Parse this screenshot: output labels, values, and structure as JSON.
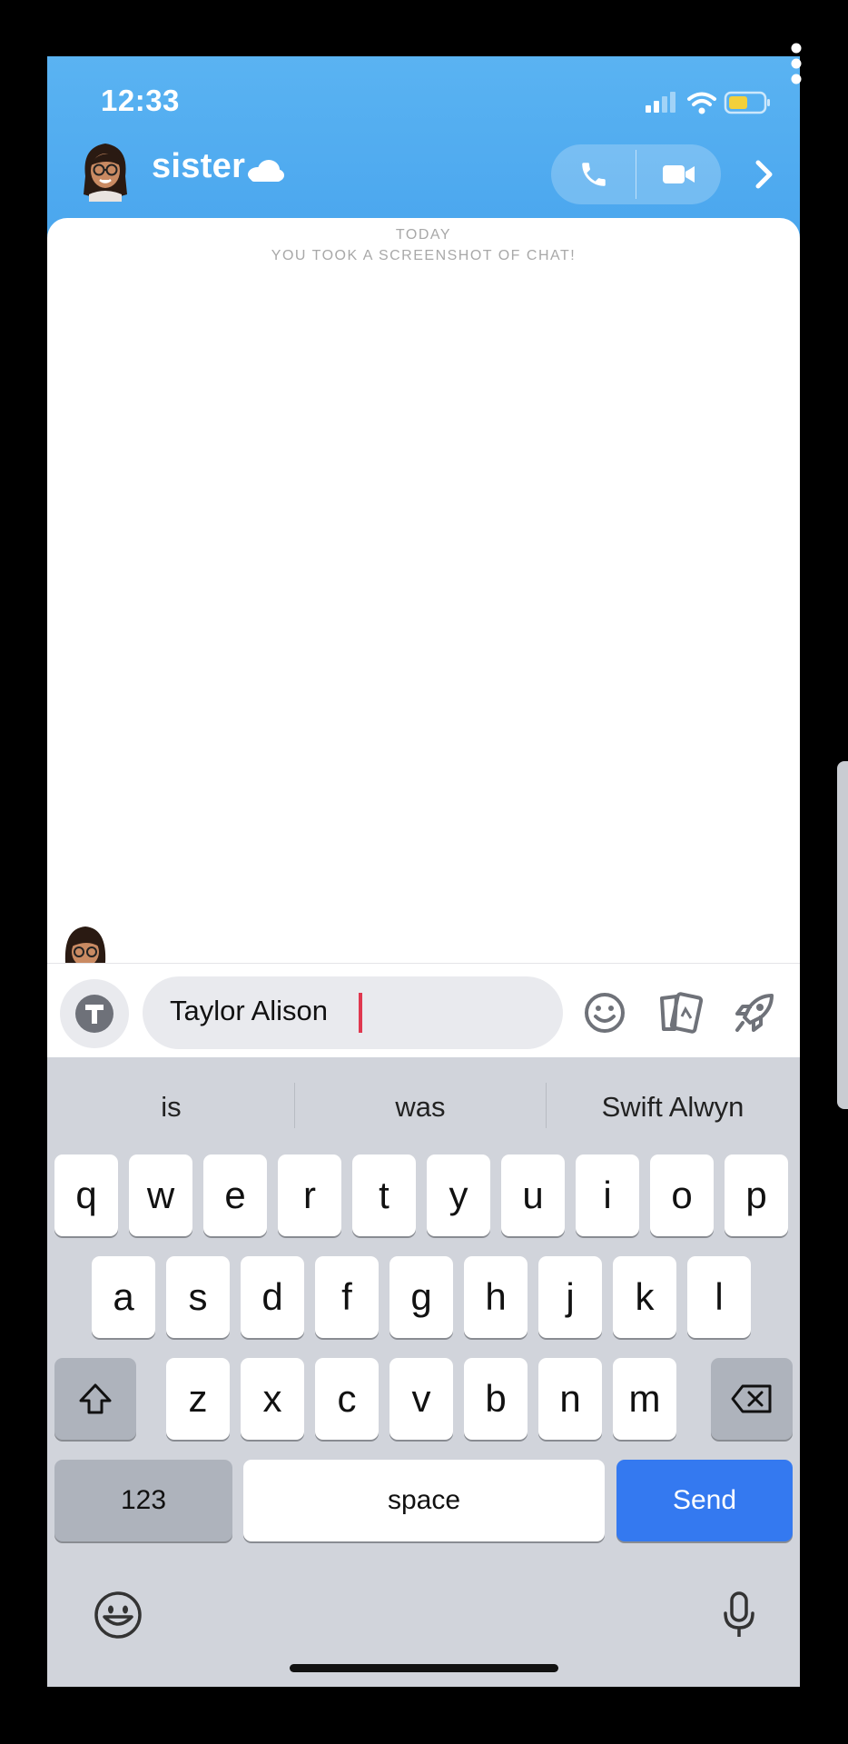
{
  "status_bar": {
    "time": "12:33"
  },
  "header": {
    "contact_name": "sister"
  },
  "chat": {
    "day_label": "TODAY",
    "notice": "YOU TOOK A SCREENSHOT OF CHAT!"
  },
  "input": {
    "value": "Taylor Alison "
  },
  "suggestions": [
    "is",
    "was",
    "Swift Alwyn"
  ],
  "keyboard": {
    "row1": [
      "q",
      "w",
      "e",
      "r",
      "t",
      "y",
      "u",
      "i",
      "o",
      "p"
    ],
    "row2": [
      "a",
      "s",
      "d",
      "f",
      "g",
      "h",
      "j",
      "k",
      "l"
    ],
    "row3": [
      "z",
      "x",
      "c",
      "v",
      "b",
      "n",
      "m"
    ],
    "numbers_label": "123",
    "space_label": "space",
    "send_label": "Send"
  },
  "colors": {
    "header_blue": "#4aa6ee",
    "send_blue": "#3479f0",
    "caret": "#e0384f"
  }
}
